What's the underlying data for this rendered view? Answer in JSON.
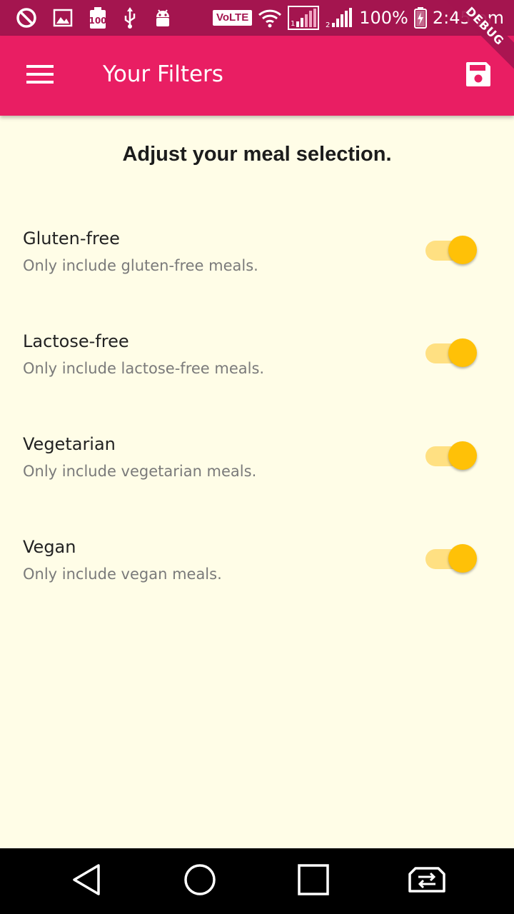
{
  "status_bar": {
    "volte": "VoLTE",
    "battery_percent": "100%",
    "time": "2:45 pm",
    "icons_left": [
      "do-not-disturb-icon",
      "image-icon",
      "battery-100-icon",
      "usb-icon",
      "android-debug-icon"
    ],
    "icons_right": [
      "volte-icon",
      "wifi-icon",
      "sim1-signal-icon",
      "sim2-signal-icon",
      "battery-charging-icon"
    ]
  },
  "debug_banner": "DEBUG",
  "app_bar": {
    "title": "Your Filters",
    "menu_icon": "hamburger-menu-icon",
    "save_icon": "save-icon"
  },
  "page": {
    "heading": "Adjust your meal selection."
  },
  "filters": [
    {
      "title": "Gluten-free",
      "subtitle": "Only include gluten-free meals.",
      "enabled": true
    },
    {
      "title": "Lactose-free",
      "subtitle": "Only include lactose-free meals.",
      "enabled": true
    },
    {
      "title": "Vegetarian",
      "subtitle": "Only include vegetarian meals.",
      "enabled": true
    },
    {
      "title": "Vegan",
      "subtitle": "Only include vegan meals.",
      "enabled": true
    }
  ],
  "nav_bar": {
    "icons": [
      "back-icon",
      "home-icon",
      "recents-icon",
      "switch-sim-icon"
    ]
  },
  "colors": {
    "status_bar": "#A4154F",
    "app_bar": "#E91E63",
    "background": "#FFFDE7",
    "switch_thumb": "#FFC107",
    "switch_track": "#FFE082"
  }
}
